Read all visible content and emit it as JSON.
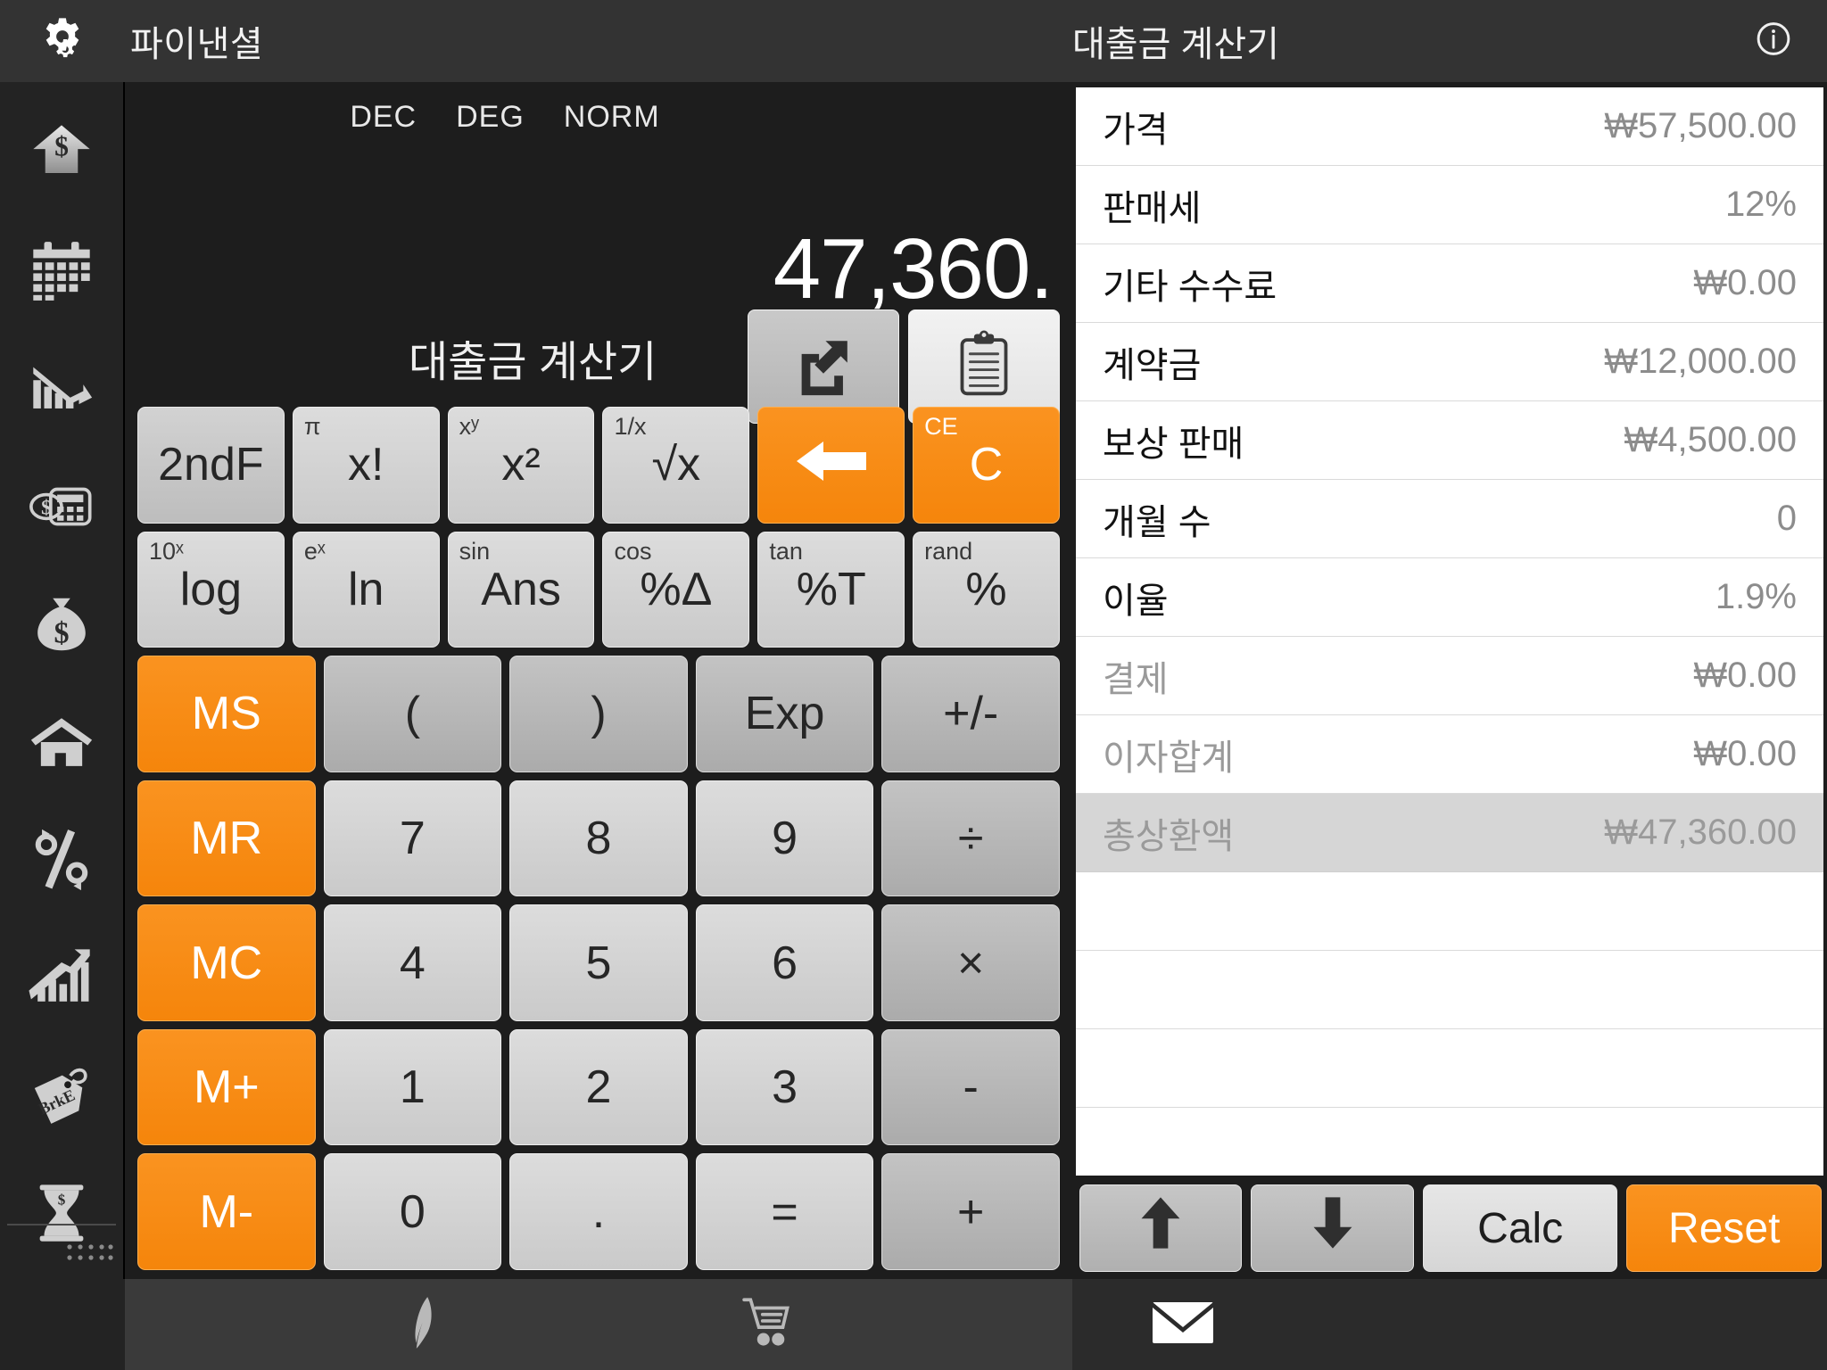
{
  "topbar": {
    "gear_icon": "gear-icon",
    "app_title": "파이낸셜",
    "doc_title": "대출금 계산기",
    "info_icon": "info-icon"
  },
  "sidebar": {
    "items": [
      {
        "icon": "dollar-arrow-up-icon"
      },
      {
        "icon": "calendar-icon"
      },
      {
        "icon": "chart-decline-icon"
      },
      {
        "icon": "calculator-dollar-icon"
      },
      {
        "icon": "money-bag-icon"
      },
      {
        "icon": "house-icon"
      },
      {
        "icon": "percent-arrows-icon"
      },
      {
        "icon": "chart-growth-icon"
      },
      {
        "icon": "price-tag-brke-icon",
        "tag_text": "BrkE"
      },
      {
        "icon": "hourglass-dollar-icon"
      }
    ],
    "grip_icon": "drag-grip-icon"
  },
  "calculator": {
    "modes": [
      "DEC",
      "DEG",
      "NORM"
    ],
    "display_value": "47,360.",
    "subtitle": "대출금 계산기",
    "display_buttons": [
      {
        "name": "export-button",
        "icon": "export-arrow-icon"
      },
      {
        "name": "clipboard-button",
        "icon": "clipboard-icon"
      }
    ],
    "rows": [
      [
        {
          "main": "2ndF",
          "sup": "",
          "style": "grey"
        },
        {
          "main": "x!",
          "sup": "π",
          "style": "lite"
        },
        {
          "main": "x²",
          "sup": "xʸ",
          "style": "lite"
        },
        {
          "main": "√x",
          "sup": "1/x",
          "style": "lite"
        },
        {
          "main": "←",
          "sup": "",
          "style": "orange",
          "icon": "backspace-arrow-icon"
        },
        {
          "main": "C",
          "sup": "CE",
          "style": "orange"
        }
      ],
      [
        {
          "main": "log",
          "sup": "10ˣ",
          "style": "lite"
        },
        {
          "main": "ln",
          "sup": "eˣ",
          "style": "lite"
        },
        {
          "main": "Ans",
          "sup": "sin",
          "style": "lite"
        },
        {
          "main": "%Δ",
          "sup": "cos",
          "style": "lite"
        },
        {
          "main": "%T",
          "sup": "tan",
          "style": "lite"
        },
        {
          "main": "%",
          "sup": "rand",
          "style": "lite"
        }
      ],
      [
        {
          "main": "MS",
          "sup": "",
          "style": "orange"
        },
        {
          "main": "(",
          "sup": "",
          "style": "dark"
        },
        {
          "main": ")",
          "sup": "",
          "style": "dark"
        },
        {
          "main": "Exp",
          "sup": "",
          "style": "dark"
        },
        {
          "main": "+/-",
          "sup": "",
          "style": "dark"
        }
      ],
      [
        {
          "main": "MR",
          "sup": "",
          "style": "orange"
        },
        {
          "main": "7",
          "sup": "",
          "style": "lite"
        },
        {
          "main": "8",
          "sup": "",
          "style": "lite"
        },
        {
          "main": "9",
          "sup": "",
          "style": "lite"
        },
        {
          "main": "÷",
          "sup": "",
          "style": "dark"
        }
      ],
      [
        {
          "main": "MC",
          "sup": "",
          "style": "orange"
        },
        {
          "main": "4",
          "sup": "",
          "style": "lite"
        },
        {
          "main": "5",
          "sup": "",
          "style": "lite"
        },
        {
          "main": "6",
          "sup": "",
          "style": "lite"
        },
        {
          "main": "×",
          "sup": "",
          "style": "dark"
        }
      ],
      [
        {
          "main": "M+",
          "sup": "",
          "style": "orange"
        },
        {
          "main": "1",
          "sup": "",
          "style": "lite"
        },
        {
          "main": "2",
          "sup": "",
          "style": "lite"
        },
        {
          "main": "3",
          "sup": "",
          "style": "lite"
        },
        {
          "main": "-",
          "sup": "",
          "style": "dark"
        }
      ],
      [
        {
          "main": "M-",
          "sup": "",
          "style": "orange"
        },
        {
          "main": "0",
          "sup": "",
          "style": "lite"
        },
        {
          "main": ".",
          "sup": "",
          "style": "lite"
        },
        {
          "main": "=",
          "sup": "",
          "style": "lite"
        },
        {
          "main": "+",
          "sup": "",
          "style": "dark"
        }
      ]
    ]
  },
  "panel": {
    "rows": [
      {
        "label": "가격",
        "value": "₩57,500.00",
        "state": "normal"
      },
      {
        "label": "판매세",
        "value": "12%",
        "state": "normal"
      },
      {
        "label": "기타 수수료",
        "value": "₩0.00",
        "state": "normal"
      },
      {
        "label": "계약금",
        "value": "₩12,000.00",
        "state": "normal"
      },
      {
        "label": "보상 판매",
        "value": "₩4,500.00",
        "state": "normal"
      },
      {
        "label": "개월 수",
        "value": "0",
        "state": "normal"
      },
      {
        "label": "이율",
        "value": "1.9%",
        "state": "normal"
      },
      {
        "label": "결제",
        "value": "₩0.00",
        "state": "muted"
      },
      {
        "label": "이자합계",
        "value": "₩0.00",
        "state": "muted"
      },
      {
        "label": "총상환액",
        "value": "₩47,360.00",
        "state": "total"
      },
      {
        "label": "",
        "value": "",
        "state": "empty"
      },
      {
        "label": "",
        "value": "",
        "state": "empty"
      },
      {
        "label": "",
        "value": "",
        "state": "empty"
      }
    ],
    "buttons": [
      {
        "name": "scroll-up-button",
        "label": "",
        "icon": "arrow-up-icon",
        "style": "grey"
      },
      {
        "name": "scroll-down-button",
        "label": "",
        "icon": "arrow-down-icon",
        "style": "grey"
      },
      {
        "name": "calc-button",
        "label": "Calc",
        "icon": "",
        "style": "lite"
      },
      {
        "name": "reset-button",
        "label": "Reset",
        "icon": "",
        "style": "orange"
      }
    ]
  },
  "bottombar": {
    "items": [
      {
        "icon": "feather-pen-icon"
      },
      {
        "icon": "shopping-cart-icon"
      },
      {
        "icon": "envelope-icon"
      }
    ]
  },
  "colors": {
    "accent_orange": "#f5850b",
    "panel_bg": "#ffffff",
    "chrome_dark": "#333333",
    "total_row_bg": "#d6d6d6"
  }
}
